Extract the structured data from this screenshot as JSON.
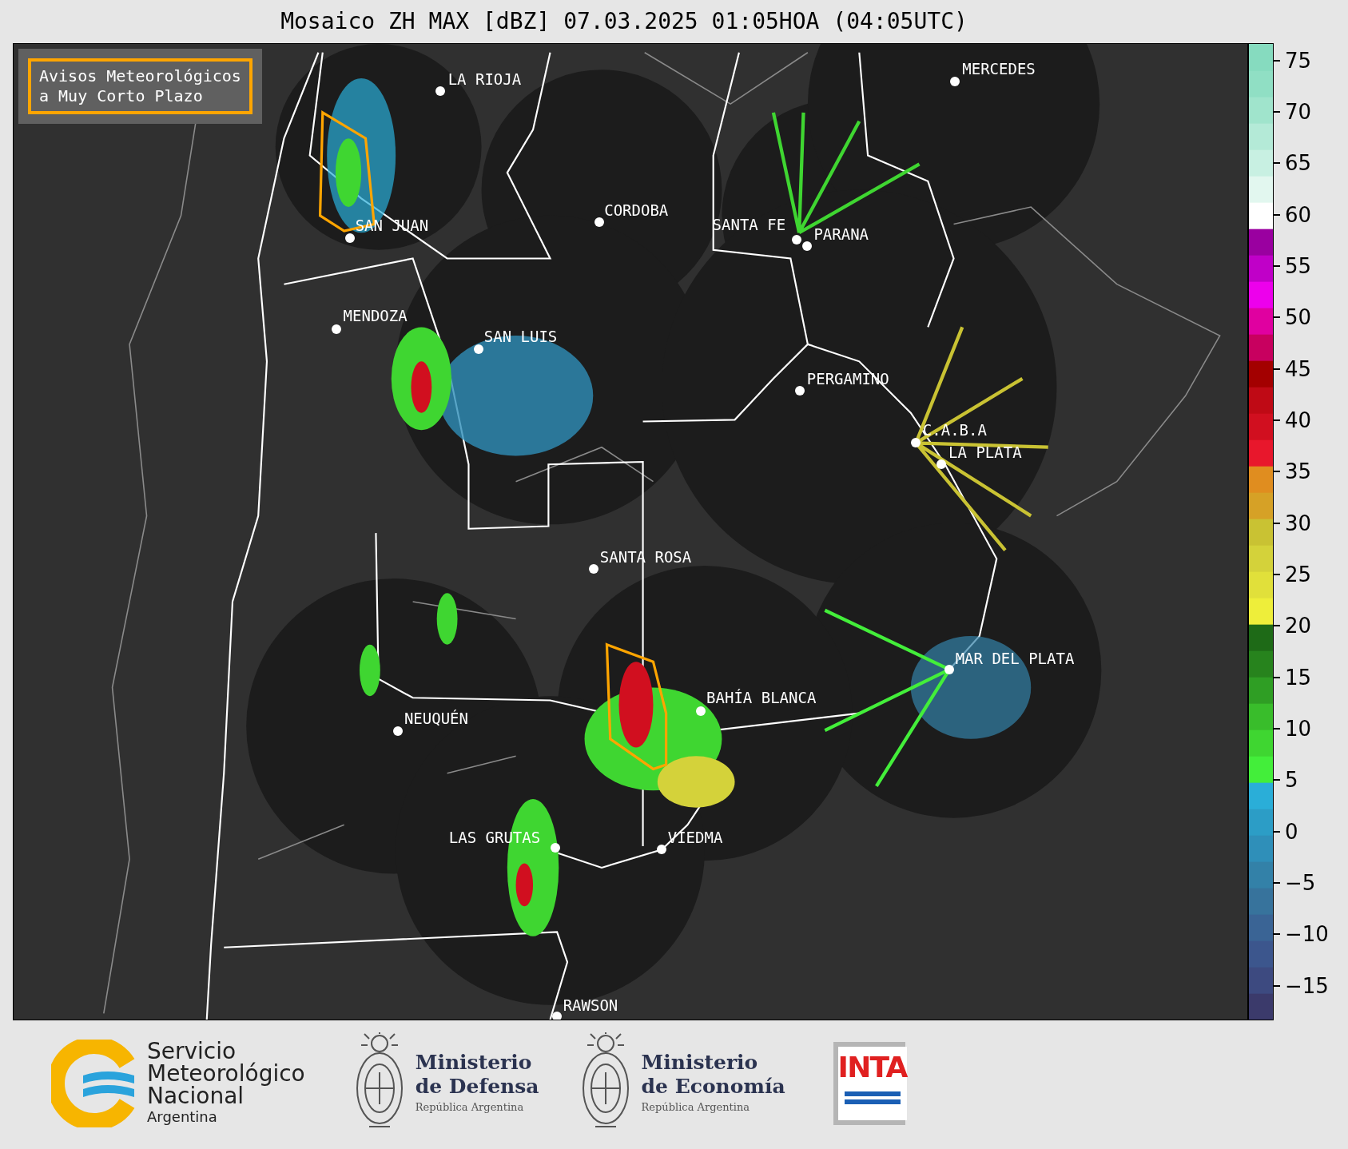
{
  "title": "Mosaico ZH MAX [dBZ] 07.03.2025 01:05HOA (04:05UTC)",
  "warning_legend": {
    "lines": [
      "Avisos Meteorológicos",
      "a Muy Corto Plazo"
    ]
  },
  "cities": [
    {
      "name": "LA RIOJA"
    },
    {
      "name": "MERCEDES"
    },
    {
      "name": "SAN JUAN"
    },
    {
      "name": "CORDOBA"
    },
    {
      "name": "SANTA FE"
    },
    {
      "name": "PARANA"
    },
    {
      "name": "MENDOZA"
    },
    {
      "name": "SAN LUIS"
    },
    {
      "name": "PERGAMINO"
    },
    {
      "name": "C.A.B.A"
    },
    {
      "name": "LA PLATA"
    },
    {
      "name": "SANTA ROSA"
    },
    {
      "name": "MAR DEL PLATA"
    },
    {
      "name": "BAHÍA BLANCA"
    },
    {
      "name": "NEUQUÉN"
    },
    {
      "name": "LAS GRUTAS"
    },
    {
      "name": "VIEDMA"
    },
    {
      "name": "RAWSON"
    }
  ],
  "colorbar": {
    "ticks": [
      "75",
      "70",
      "65",
      "60",
      "55",
      "50",
      "45",
      "40",
      "35",
      "30",
      "25",
      "20",
      "15",
      "10",
      "5",
      "0",
      "−5",
      "−10",
      "−15"
    ]
  },
  "logos": [
    {
      "kind": "smn",
      "lines": [
        "Servicio",
        "Meteorológico",
        "Nacional"
      ],
      "subtitle": "Argentina"
    },
    {
      "kind": "ministry",
      "lines": [
        "Ministerio",
        "de Defensa"
      ],
      "subtitle": "República Argentina"
    },
    {
      "kind": "ministry",
      "lines": [
        "Ministerio",
        "de Economía"
      ],
      "subtitle": "República Argentina"
    },
    {
      "kind": "inta",
      "text": "INTA"
    }
  ]
}
